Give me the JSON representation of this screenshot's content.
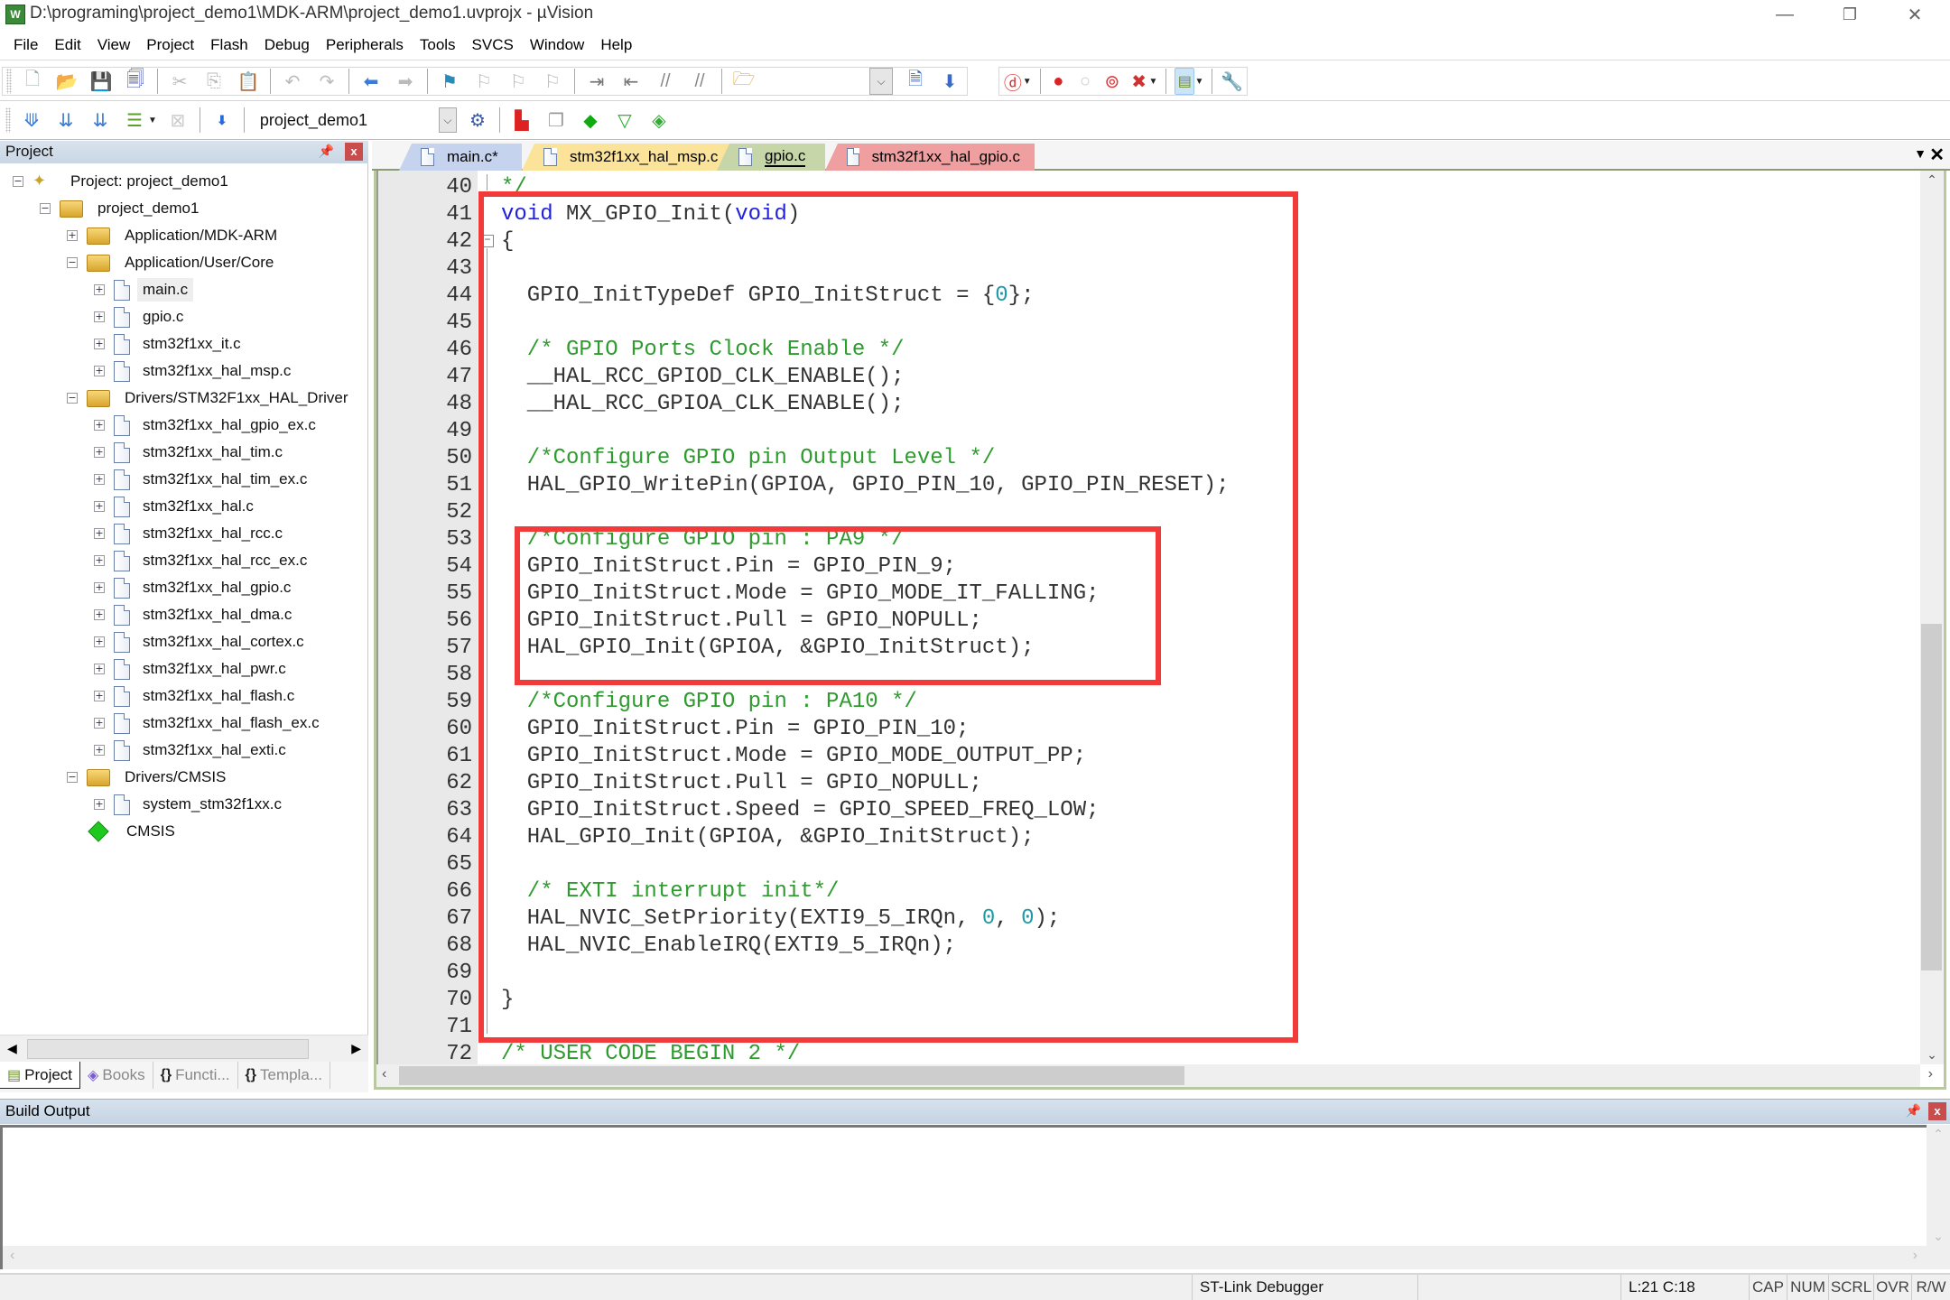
{
  "window": {
    "title": "D:\\programing\\project_demo1\\MDK-ARM\\project_demo1.uvprojx - µVision",
    "app_icon": "uvision-logo-icon",
    "controls": {
      "minimize": "—",
      "restore": "❐",
      "close": "✕"
    }
  },
  "menu": [
    "File",
    "Edit",
    "View",
    "Project",
    "Flash",
    "Debug",
    "Peripherals",
    "Tools",
    "SVCS",
    "Window",
    "Help"
  ],
  "toolbar": {
    "target_name": "project_demo1"
  },
  "project_panel": {
    "title": "Project",
    "tree": [
      {
        "level": 0,
        "type": "project",
        "label": "Project: project_demo1",
        "expander": "−"
      },
      {
        "level": 1,
        "type": "target",
        "label": "project_demo1",
        "expander": "−"
      },
      {
        "level": 2,
        "type": "folder",
        "label": "Application/MDK-ARM",
        "expander": "+"
      },
      {
        "level": 2,
        "type": "folder",
        "label": "Application/User/Core",
        "expander": "−"
      },
      {
        "level": 3,
        "type": "file",
        "label": "main.c",
        "expander": "+",
        "selected": true
      },
      {
        "level": 3,
        "type": "file",
        "label": "gpio.c",
        "expander": "+"
      },
      {
        "level": 3,
        "type": "file",
        "label": "stm32f1xx_it.c",
        "expander": "+"
      },
      {
        "level": 3,
        "type": "file",
        "label": "stm32f1xx_hal_msp.c",
        "expander": "+"
      },
      {
        "level": 2,
        "type": "folder",
        "label": "Drivers/STM32F1xx_HAL_Driver",
        "expander": "−"
      },
      {
        "level": 3,
        "type": "file",
        "label": "stm32f1xx_hal_gpio_ex.c",
        "expander": "+"
      },
      {
        "level": 3,
        "type": "file",
        "label": "stm32f1xx_hal_tim.c",
        "expander": "+"
      },
      {
        "level": 3,
        "type": "file",
        "label": "stm32f1xx_hal_tim_ex.c",
        "expander": "+"
      },
      {
        "level": 3,
        "type": "file",
        "label": "stm32f1xx_hal.c",
        "expander": "+"
      },
      {
        "level": 3,
        "type": "file",
        "label": "stm32f1xx_hal_rcc.c",
        "expander": "+"
      },
      {
        "level": 3,
        "type": "file",
        "label": "stm32f1xx_hal_rcc_ex.c",
        "expander": "+"
      },
      {
        "level": 3,
        "type": "file",
        "label": "stm32f1xx_hal_gpio.c",
        "expander": "+"
      },
      {
        "level": 3,
        "type": "file",
        "label": "stm32f1xx_hal_dma.c",
        "expander": "+"
      },
      {
        "level": 3,
        "type": "file",
        "label": "stm32f1xx_hal_cortex.c",
        "expander": "+"
      },
      {
        "level": 3,
        "type": "file",
        "label": "stm32f1xx_hal_pwr.c",
        "expander": "+"
      },
      {
        "level": 3,
        "type": "file",
        "label": "stm32f1xx_hal_flash.c",
        "expander": "+"
      },
      {
        "level": 3,
        "type": "file",
        "label": "stm32f1xx_hal_flash_ex.c",
        "expander": "+"
      },
      {
        "level": 3,
        "type": "file",
        "label": "stm32f1xx_hal_exti.c",
        "expander": "+"
      },
      {
        "level": 2,
        "type": "folder",
        "label": "Drivers/CMSIS",
        "expander": "−"
      },
      {
        "level": 3,
        "type": "file",
        "label": "system_stm32f1xx.c",
        "expander": "+"
      },
      {
        "level": 2,
        "type": "component",
        "label": "CMSIS",
        "expander": ""
      }
    ],
    "bottom_tabs": [
      {
        "label": "Project",
        "icon": "▤",
        "active": true
      },
      {
        "label": "Books",
        "icon": "◈",
        "active": false
      },
      {
        "label": "Functi...",
        "icon": "{}",
        "active": false
      },
      {
        "label": "Templa...",
        "icon": "{}",
        "active": false
      }
    ]
  },
  "editor": {
    "tabs": [
      {
        "label": "main.c*",
        "color": "#c5d3ee",
        "active": false
      },
      {
        "label": "stm32f1xx_hal_msp.c",
        "color": "#fbe39a",
        "active": false
      },
      {
        "label": "gpio.c",
        "color": "#c6d6a8",
        "active": true
      },
      {
        "label": "stm32f1xx_hal_gpio.c",
        "color": "#ef9f9f",
        "active": false
      }
    ],
    "lines": [
      {
        "n": "40",
        "parts": [
          {
            "t": "*/",
            "c": "cm"
          }
        ]
      },
      {
        "n": "41",
        "parts": [
          {
            "t": "void",
            "c": "kw"
          },
          {
            "t": " MX_GPIO_Init(",
            "c": ""
          },
          {
            "t": "void",
            "c": "kw"
          },
          {
            "t": ")",
            "c": ""
          }
        ]
      },
      {
        "n": "42",
        "parts": [
          {
            "t": "{",
            "c": ""
          }
        ]
      },
      {
        "n": "43",
        "parts": []
      },
      {
        "n": "44",
        "parts": [
          {
            "t": "  GPIO_InitTypeDef GPIO_InitStruct = {",
            "c": ""
          },
          {
            "t": "0",
            "c": "num"
          },
          {
            "t": "};",
            "c": ""
          }
        ]
      },
      {
        "n": "45",
        "parts": []
      },
      {
        "n": "46",
        "parts": [
          {
            "t": "  /* GPIO Ports Clock Enable */",
            "c": "cm"
          }
        ]
      },
      {
        "n": "47",
        "parts": [
          {
            "t": "  __HAL_RCC_GPIOD_CLK_ENABLE();",
            "c": ""
          }
        ]
      },
      {
        "n": "48",
        "parts": [
          {
            "t": "  __HAL_RCC_GPIOA_CLK_ENABLE();",
            "c": ""
          }
        ]
      },
      {
        "n": "49",
        "parts": []
      },
      {
        "n": "50",
        "parts": [
          {
            "t": "  /*Configure GPIO pin Output Level */",
            "c": "cm"
          }
        ]
      },
      {
        "n": "51",
        "parts": [
          {
            "t": "  HAL_GPIO_WritePin(GPIOA, GPIO_PIN_10, GPIO_PIN_RESET);",
            "c": ""
          }
        ]
      },
      {
        "n": "52",
        "parts": []
      },
      {
        "n": "53",
        "parts": [
          {
            "t": "  /*Configure GPIO pin : PA9 */",
            "c": "cm"
          }
        ]
      },
      {
        "n": "54",
        "parts": [
          {
            "t": "  GPIO_InitStruct.Pin = GPIO_PIN_9;",
            "c": ""
          }
        ]
      },
      {
        "n": "55",
        "parts": [
          {
            "t": "  GPIO_InitStruct.Mode = GPIO_MODE_IT_FALLING;",
            "c": ""
          }
        ]
      },
      {
        "n": "56",
        "parts": [
          {
            "t": "  GPIO_InitStruct.Pull = GPIO_NOPULL;",
            "c": ""
          }
        ]
      },
      {
        "n": "57",
        "parts": [
          {
            "t": "  HAL_GPIO_Init(GPIOA, &GPIO_InitStruct);",
            "c": ""
          }
        ]
      },
      {
        "n": "58",
        "parts": []
      },
      {
        "n": "59",
        "parts": [
          {
            "t": "  /*Configure GPIO pin : PA10 */",
            "c": "cm"
          }
        ]
      },
      {
        "n": "60",
        "parts": [
          {
            "t": "  GPIO_InitStruct.Pin = GPIO_PIN_10;",
            "c": ""
          }
        ]
      },
      {
        "n": "61",
        "parts": [
          {
            "t": "  GPIO_InitStruct.Mode = GPIO_MODE_OUTPUT_PP;",
            "c": ""
          }
        ]
      },
      {
        "n": "62",
        "parts": [
          {
            "t": "  GPIO_InitStruct.Pull = GPIO_NOPULL;",
            "c": ""
          }
        ]
      },
      {
        "n": "63",
        "parts": [
          {
            "t": "  GPIO_InitStruct.Speed = GPIO_SPEED_FREQ_LOW;",
            "c": ""
          }
        ]
      },
      {
        "n": "64",
        "parts": [
          {
            "t": "  HAL_GPIO_Init(GPIOA, &GPIO_InitStruct);",
            "c": ""
          }
        ]
      },
      {
        "n": "65",
        "parts": []
      },
      {
        "n": "66",
        "parts": [
          {
            "t": "  /* EXTI interrupt init*/",
            "c": "cm"
          }
        ]
      },
      {
        "n": "67",
        "parts": [
          {
            "t": "  HAL_NVIC_SetPriority(EXTI9_5_IRQn, ",
            "c": ""
          },
          {
            "t": "0",
            "c": "num"
          },
          {
            "t": ", ",
            "c": ""
          },
          {
            "t": "0",
            "c": "num"
          },
          {
            "t": ");",
            "c": ""
          }
        ]
      },
      {
        "n": "68",
        "parts": [
          {
            "t": "  HAL_NVIC_EnableIRQ(EXTI9_5_IRQn);",
            "c": ""
          }
        ]
      },
      {
        "n": "69",
        "parts": []
      },
      {
        "n": "70",
        "parts": [
          {
            "t": "}",
            "c": ""
          }
        ]
      },
      {
        "n": "71",
        "parts": []
      },
      {
        "n": "72",
        "parts": [
          {
            "t": "/* USER CODE BEGIN 2 */",
            "c": "cm"
          }
        ]
      }
    ],
    "highlight_color": "#f23a3a"
  },
  "build_output": {
    "title": "Build Output",
    "content": ""
  },
  "status_bar": {
    "debugger": "ST-Link Debugger",
    "position": "L:21 C:18",
    "indicators": [
      "CAP",
      "NUM",
      "SCRL",
      "OVR",
      "R/W"
    ]
  }
}
